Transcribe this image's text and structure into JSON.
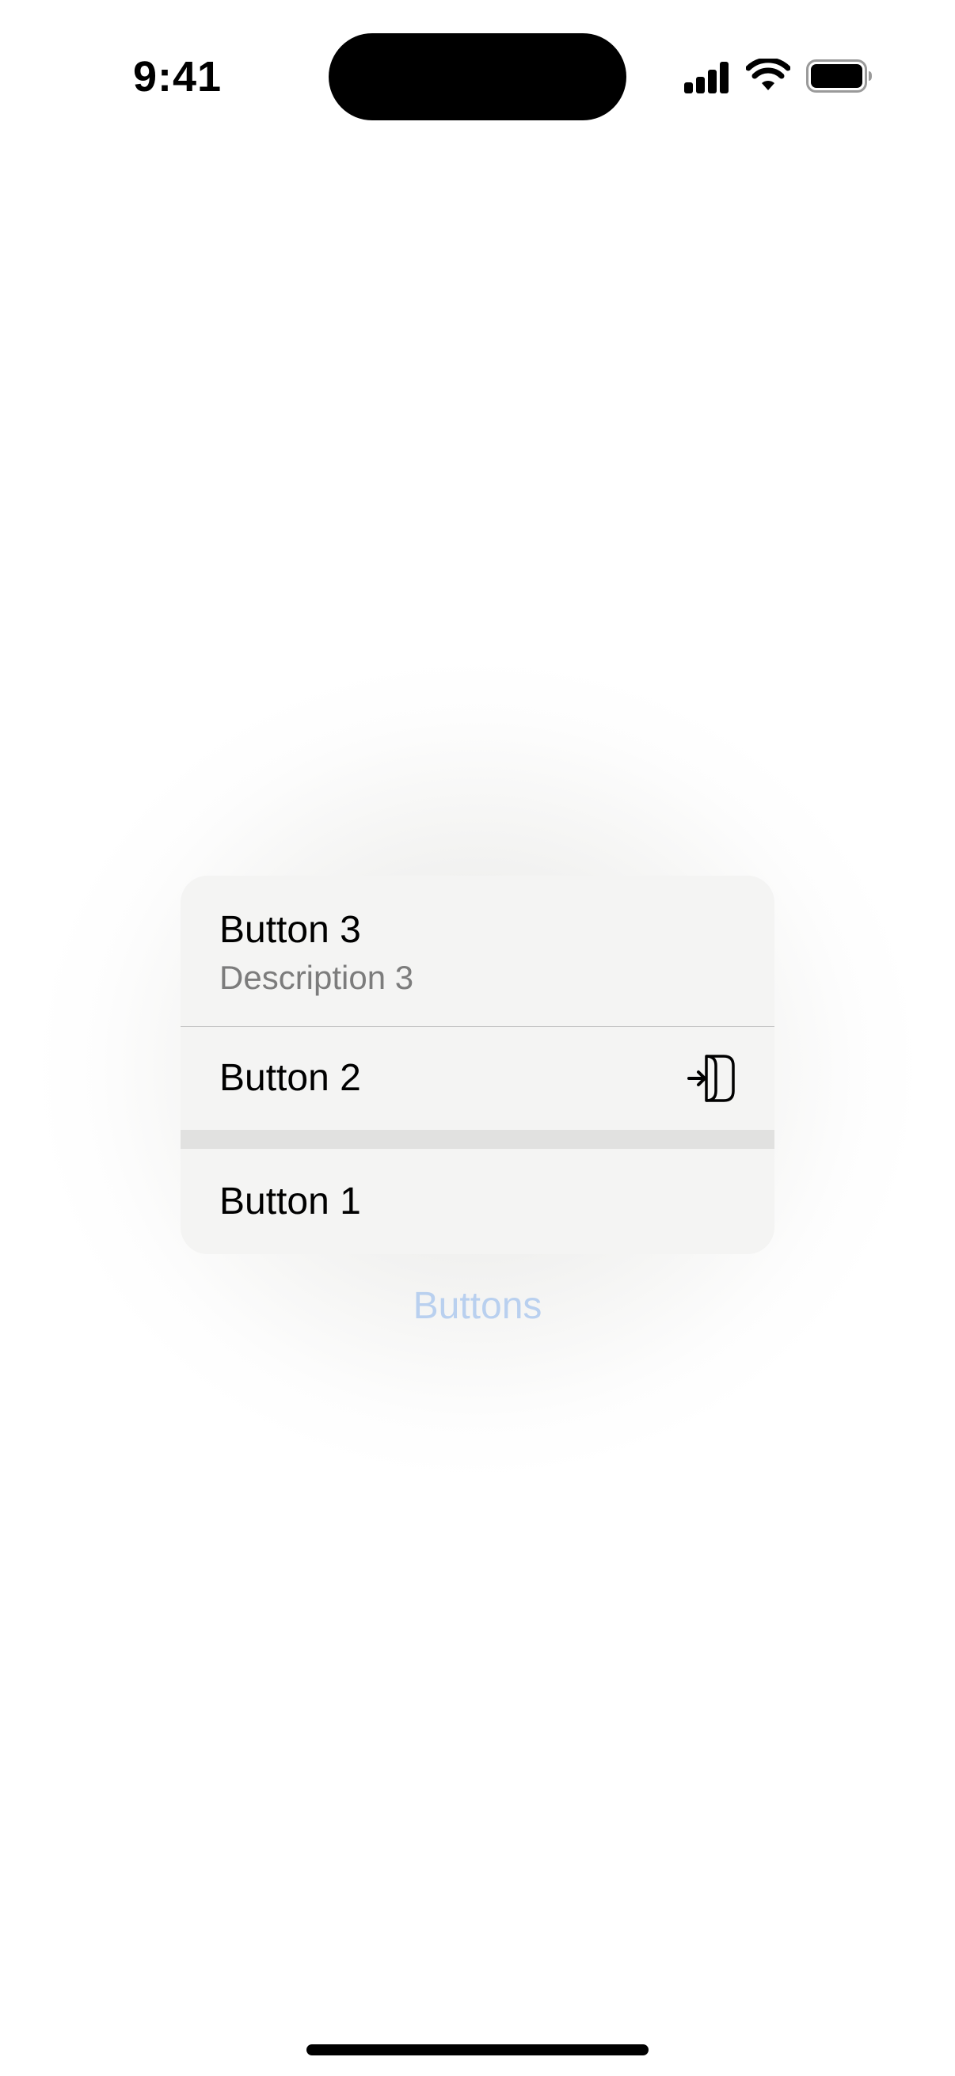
{
  "status_bar": {
    "time": "9:41",
    "icons": [
      "cellular-signal-icon",
      "wifi-icon",
      "battery-icon"
    ]
  },
  "menu": {
    "items": [
      {
        "label": "Button 3",
        "description": "Description 3"
      },
      {
        "label": "Button 2",
        "icon": "enter-door-icon"
      },
      {
        "label": "Button 1"
      }
    ]
  },
  "caption": "Buttons",
  "colors": {
    "caption_text": "#b9d0ef",
    "menu_background": "#f4f4f3",
    "description_text": "#7c7c7c"
  }
}
